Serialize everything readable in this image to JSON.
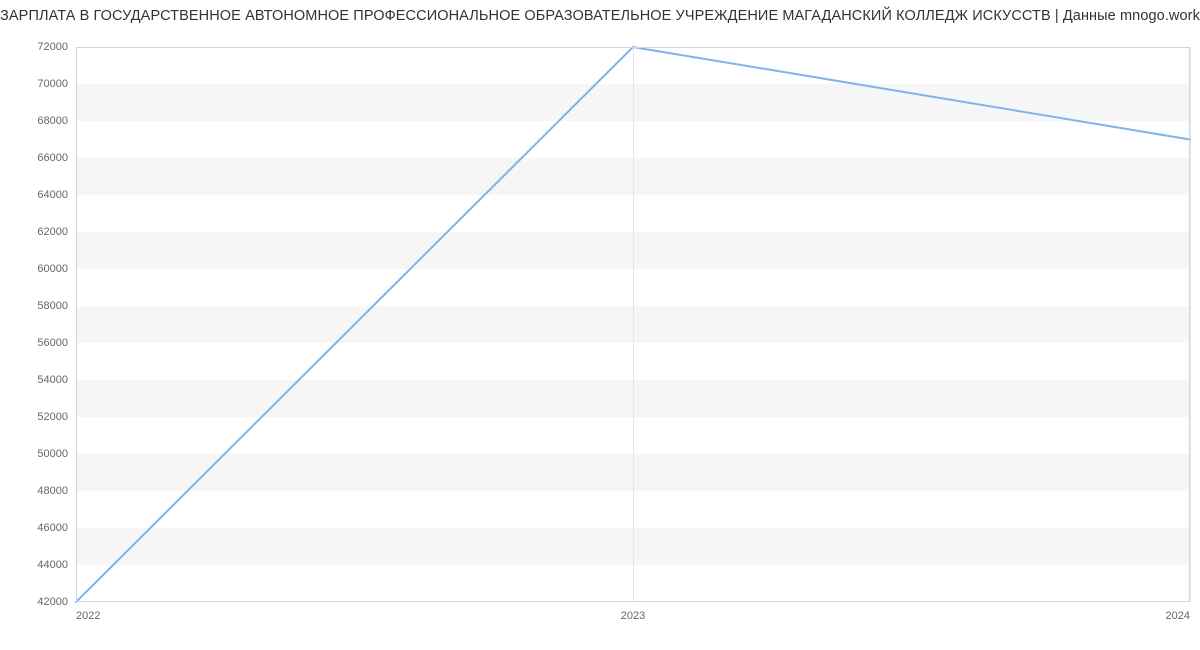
{
  "chart_data": {
    "type": "line",
    "title": "ЗАРПЛАТА В ГОСУДАРСТВЕННОЕ АВТОНОМНОЕ ПРОФЕССИОНАЛЬНОЕ ОБРАЗОВАТЕЛЬНОЕ УЧРЕЖДЕНИЕ МАГАДАНСКИЙ КОЛЛЕДЖ ИСКУССТВ | Данные mnogo.work",
    "x": [
      2022,
      2023,
      2024
    ],
    "x_labels": [
      "2022",
      "2023",
      "2024"
    ],
    "values": [
      42000,
      72000,
      67000
    ],
    "ylim": [
      42000,
      72000
    ],
    "xlim": [
      2022,
      2024
    ],
    "y_ticks": [
      42000,
      44000,
      46000,
      48000,
      50000,
      52000,
      54000,
      56000,
      58000,
      60000,
      62000,
      64000,
      66000,
      68000,
      70000,
      72000
    ],
    "line_color": "#7cb5ec",
    "xlabel": "",
    "ylabel": ""
  }
}
